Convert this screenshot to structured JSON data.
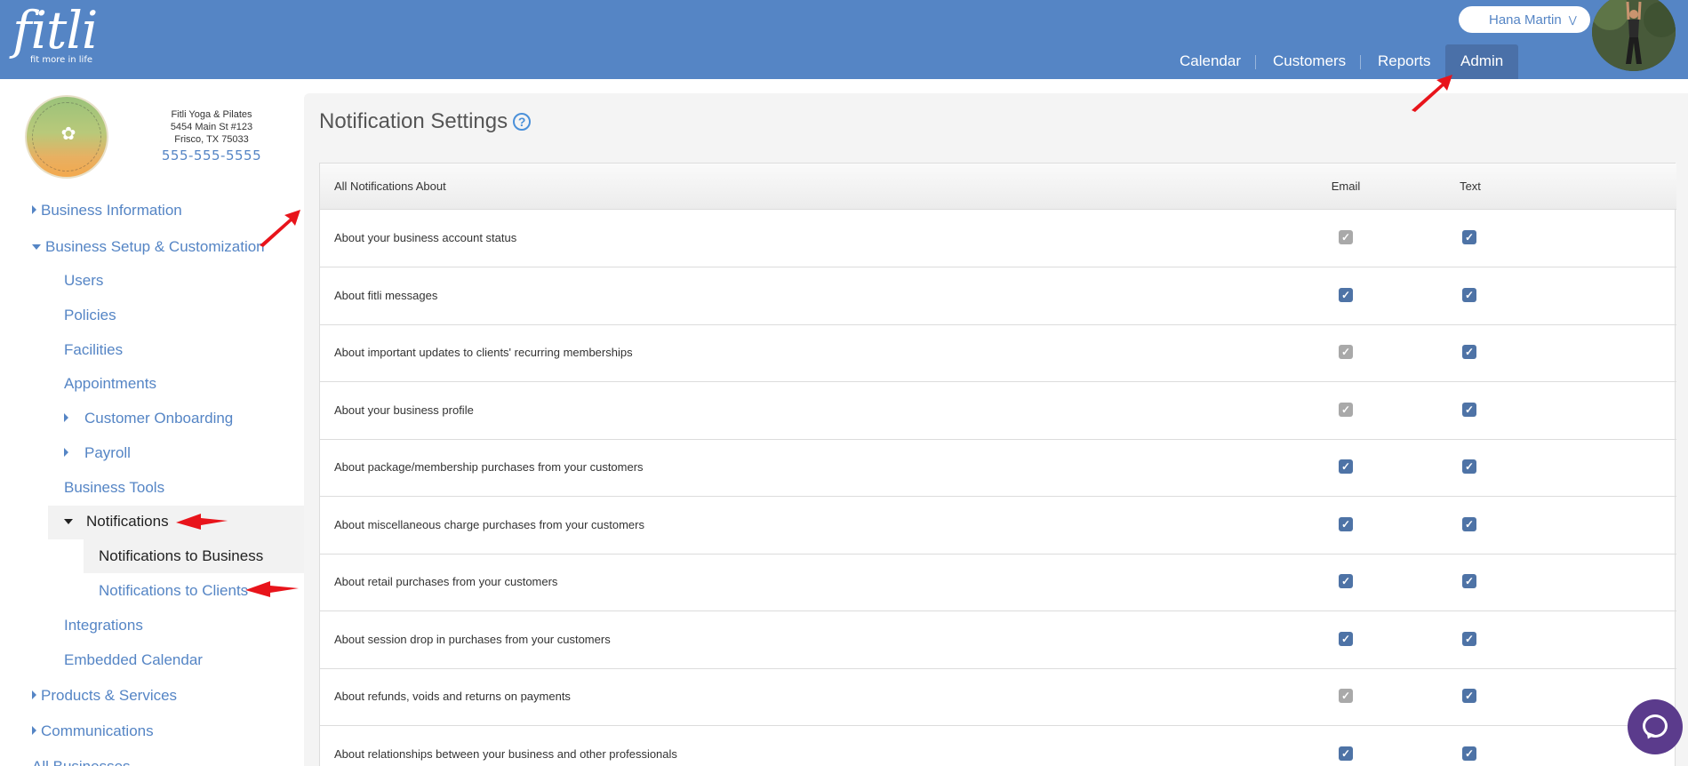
{
  "header": {
    "logo_text": "fitli",
    "logo_tagline": "fit more in life",
    "user_name": "Hana Martin",
    "nav": [
      "Calendar",
      "Customers",
      "Reports",
      "Admin"
    ]
  },
  "business": {
    "name": "Fitli Yoga & Pilates",
    "address_line1": "5454 Main St #123",
    "address_line2": "Frisco, TX 75033",
    "phone": "555-555-5555",
    "logo_text": "FITLI YOGA & PILATES"
  },
  "sidebar": {
    "items": {
      "business_information": "Business Information",
      "business_setup": "Business Setup & Customization",
      "users": "Users",
      "policies": "Policies",
      "facilities": "Facilities",
      "appointments": "Appointments",
      "customer_onboarding": "Customer Onboarding",
      "payroll": "Payroll",
      "business_tools": "Business Tools",
      "notifications": "Notifications",
      "notifications_to_business": "Notifications to Business",
      "notifications_to_clients": "Notifications to Clients",
      "integrations": "Integrations",
      "embedded_calendar": "Embedded Calendar",
      "products_services": "Products & Services",
      "communications": "Communications",
      "all_businesses": "All Businesses"
    }
  },
  "main": {
    "title": "Notification Settings",
    "help_icon": "?",
    "table": {
      "headers": [
        "All Notifications About",
        "Email",
        "Text"
      ],
      "rows": [
        {
          "label": "About your business account status",
          "email": "disabled-checked",
          "text": "checked"
        },
        {
          "label": "About fitli messages",
          "email": "checked",
          "text": "checked"
        },
        {
          "label": "About important updates to clients' recurring memberships",
          "email": "disabled-checked",
          "text": "checked"
        },
        {
          "label": "About your business profile",
          "email": "disabled-checked",
          "text": "checked"
        },
        {
          "label": "About package/membership purchases from your customers",
          "email": "checked",
          "text": "checked"
        },
        {
          "label": "About miscellaneous charge purchases from your customers",
          "email": "checked",
          "text": "checked"
        },
        {
          "label": "About retail purchases from your customers",
          "email": "checked",
          "text": "checked"
        },
        {
          "label": "About session drop in purchases from your customers",
          "email": "checked",
          "text": "checked"
        },
        {
          "label": "About refunds, voids and returns on payments",
          "email": "disabled-checked",
          "text": "checked"
        },
        {
          "label": "About relationships between your business and other professionals",
          "email": "checked",
          "text": "checked"
        }
      ]
    }
  },
  "icons": {
    "help": "help-circle-icon",
    "chat": "chat-bubble-icon",
    "caret_right": "caret-right-icon",
    "caret_down": "caret-down-icon",
    "checkbox": "checkmark-icon",
    "user_dropdown": "chevron-double-down-icon"
  },
  "colors": {
    "header_bg": "#5585c5",
    "link": "#5585c5",
    "checkbox_on": "#4e73a6",
    "checkbox_disabled": "#a9a9a9",
    "chat_button": "#5b3b8c",
    "annotation_arrow": "#e8141b"
  }
}
